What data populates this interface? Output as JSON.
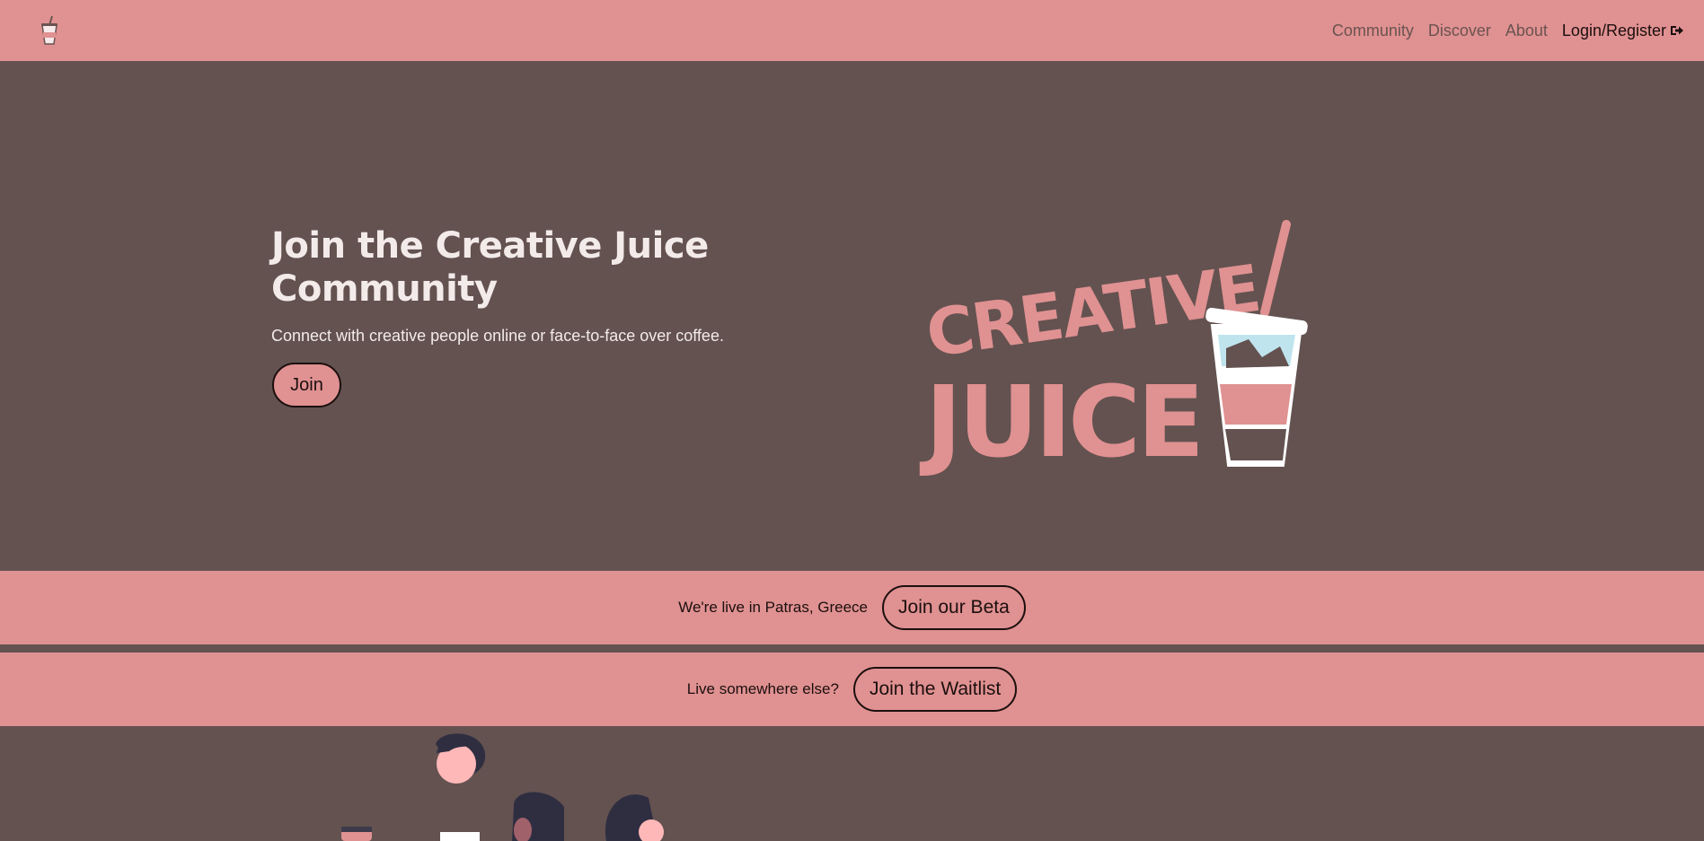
{
  "nav": {
    "logo_icon": "juice-cup-icon",
    "links": [
      "Community",
      "Discover",
      "About"
    ],
    "login_label": "Login/Register",
    "login_icon": "sign-in-icon"
  },
  "hero": {
    "title": "Join the Creative Juice Community",
    "subtitle": "Connect with creative people online or face-to-face over coffee.",
    "join_label": "Join",
    "logo_text_line1": "CREATIVE",
    "logo_text_line2": "JUICE"
  },
  "banners": {
    "beta_text": "We're live in Patras, Greece",
    "beta_button": "Join our Beta",
    "waitlist_text": "Live somewhere else?",
    "waitlist_button": "Join the Waitlist"
  },
  "colors": {
    "accent": "#e09191",
    "background": "#635250",
    "text_light": "#f3ebea",
    "text_dark": "#1b0f0e"
  }
}
